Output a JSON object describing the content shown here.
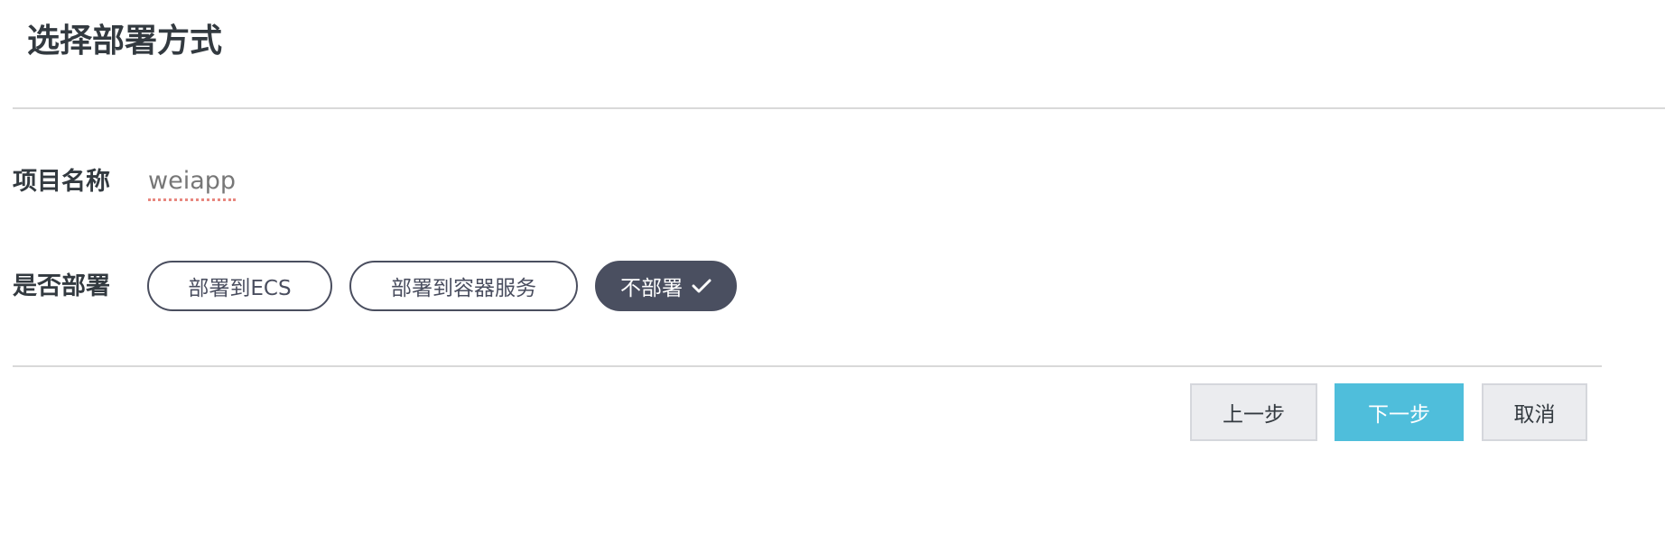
{
  "dialog": {
    "title": "选择部署方式"
  },
  "form": {
    "project_name_label": "项目名称",
    "project_name_value": "weiapp",
    "deploy_label": "是否部署",
    "deploy_options": [
      {
        "label": "部署到ECS",
        "selected": false
      },
      {
        "label": "部署到容器服务",
        "selected": false
      },
      {
        "label": "不部署",
        "selected": true
      }
    ]
  },
  "footer": {
    "prev_label": "上一步",
    "next_label": "下一步",
    "cancel_label": "取消"
  },
  "colors": {
    "selected_pill": "#4a4f60",
    "primary_button": "#4fbedb",
    "secondary_button": "#ebecef"
  },
  "icons": {
    "selected_indicator": "check-icon"
  }
}
